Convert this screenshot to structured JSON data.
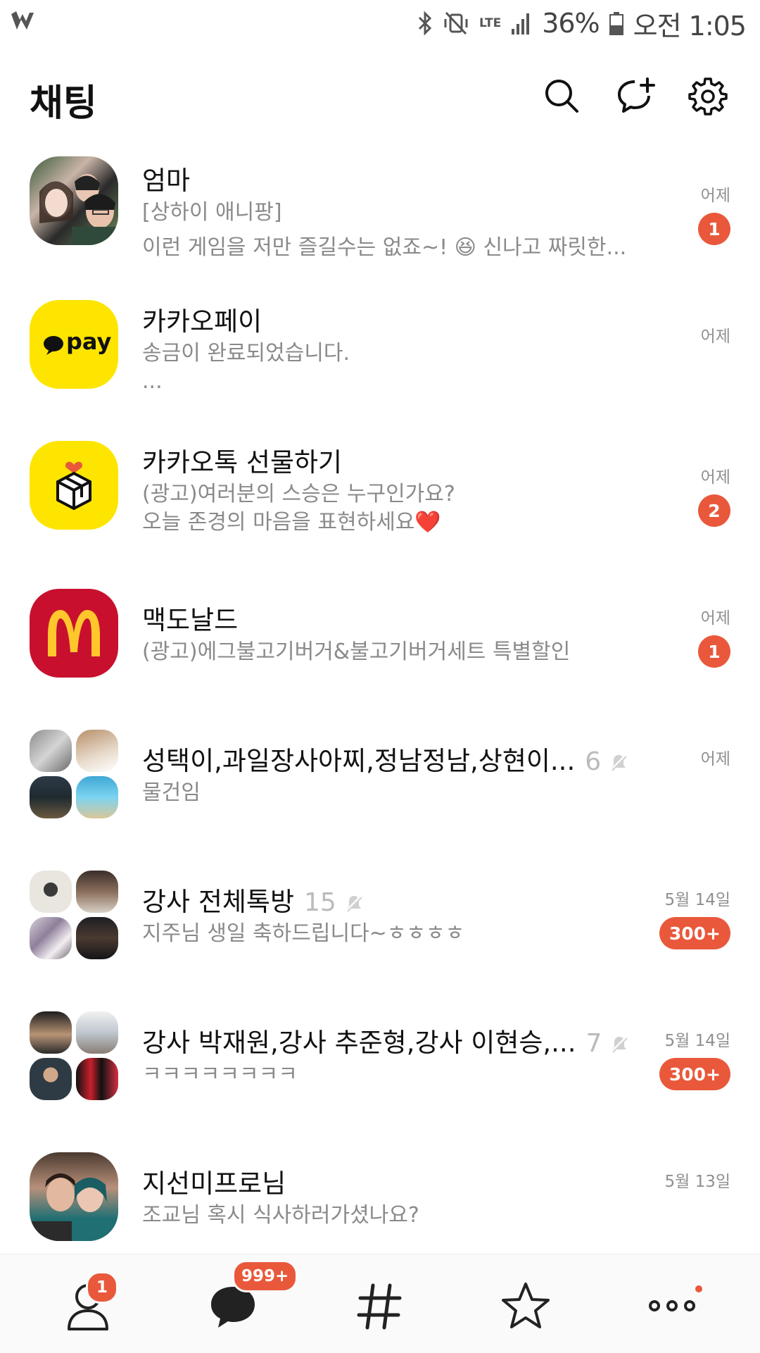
{
  "status_bar": {
    "battery": "36%",
    "time": "오전 1:05",
    "network": "LTE"
  },
  "header": {
    "title": "채팅"
  },
  "chats": [
    {
      "name": "엄마",
      "preview_line1": "[상하이 애니팡]",
      "preview_line2": "이런 게임을 저만 즐길수는 없죠~! 😆 신나고 짜릿한...",
      "time": "어제",
      "unread": "1"
    },
    {
      "name": "카카오페이",
      "preview_line1": "송금이 완료되었습니다.",
      "preview_line2": "...",
      "time": "어제",
      "unread": ""
    },
    {
      "name": "카카오톡 선물하기",
      "preview_line1": "(광고)여러분의 스승은 누구인가요?",
      "preview_line2": "오늘 존경의 마음을 표현하세요❤️",
      "time": "어제",
      "unread": "2"
    },
    {
      "name": "맥도날드",
      "preview_line1": "(광고)에그불고기버거&불고기버거세트 특별할인",
      "preview_line2": "",
      "time": "어제",
      "unread": "1"
    },
    {
      "name": "성택이,과일장사아찌,정남정남,상현이...",
      "member_count": "6",
      "preview_line1": "물건임",
      "preview_line2": "",
      "time": "어제",
      "unread": ""
    },
    {
      "name": "강사 전체톡방",
      "member_count": "15",
      "preview_line1": "지주님 생일 축하드립니다~ㅎㅎㅎㅎ",
      "preview_line2": "",
      "time": "5월 14일",
      "unread": "300+"
    },
    {
      "name": "강사 박재원,강사 추준형,강사 이현승,...",
      "member_count": "7",
      "preview_line1": "ㅋㅋㅋㅋㅋㅋㅋㅋ",
      "preview_line2": "",
      "time": "5월 14일",
      "unread": "300+"
    },
    {
      "name": "지선미프로님",
      "preview_line1": "조교님 혹시 식사하러가셨나요?",
      "preview_line2": "",
      "time": "5월 13일",
      "unread": ""
    }
  ],
  "pay_logo_text": "pay",
  "bottom_nav": {
    "friends_badge": "1",
    "chats_badge": "999+",
    "items": [
      "friends-icon",
      "chat-icon",
      "hashtag-icon",
      "star-icon",
      "more-icon"
    ]
  },
  "colors": {
    "badge": "#e9583b",
    "kakao_yellow": "#fee500",
    "mcdonalds_red": "#c8102e"
  }
}
